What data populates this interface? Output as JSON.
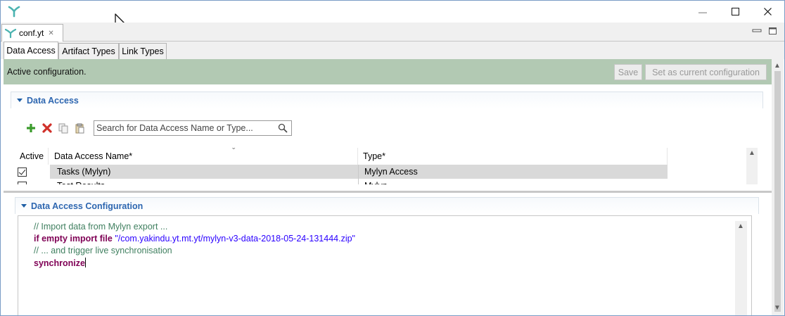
{
  "window": {
    "minimize_glyph": "—",
    "maximize_glyph": "☐",
    "close_glyph": "✕"
  },
  "editor_tab": {
    "label": "conf.yt",
    "close_glyph": "✕"
  },
  "page_tabs": [
    {
      "label": "Data Access",
      "active": true
    },
    {
      "label": "Artifact Types",
      "active": false
    },
    {
      "label": "Link Types",
      "active": false
    }
  ],
  "status": {
    "message": "Active configuration.",
    "save_label": "Save",
    "set_current_label": "Set as current configuration",
    "background_color": "#b2c9b3"
  },
  "data_access_section": {
    "title": "Data Access",
    "toolbar_icons": [
      "add-icon",
      "delete-icon",
      "copy-icon",
      "paste-icon"
    ],
    "search_placeholder": "Search for Data Access Name or Type...",
    "columns": [
      "Active",
      "Data Access Name*",
      "Type*"
    ],
    "rows": [
      {
        "active": true,
        "name": "Tasks (Mylyn)",
        "type": "Mylyn Access",
        "selected": true
      },
      {
        "active": false,
        "name": "Test Results",
        "type": "Mylyn",
        "selected": false
      }
    ]
  },
  "config_section": {
    "title": "Data Access Configuration",
    "code": {
      "line1_comment": "// Import data from Mylyn export ...",
      "line2_keyword": "if empty import file",
      "line2_string": "\"/com.yakindu.yt.mt.yt/mylyn-v3-data-2018-05-24-131444.zip\"",
      "line3_comment": "// ... and trigger live synchronisation",
      "line4_keyword": "synchronize"
    }
  },
  "colors": {
    "section_title": "#2d66b0",
    "keyword": "#7f0055",
    "string": "#2a00ff",
    "comment": "#3f7f5f"
  }
}
